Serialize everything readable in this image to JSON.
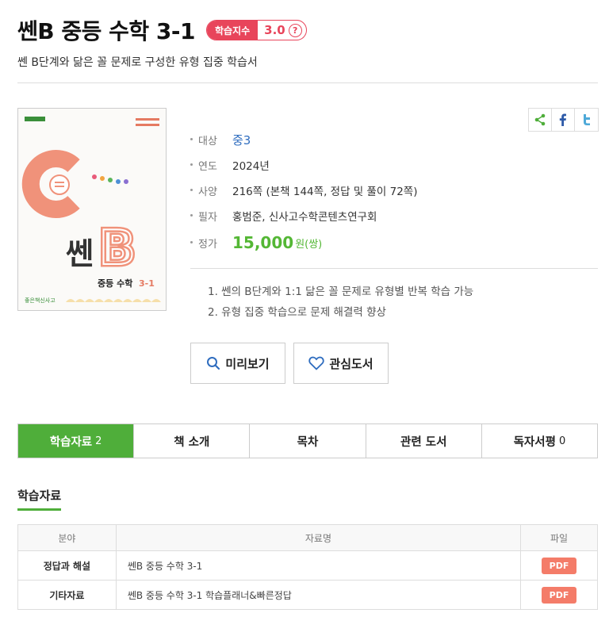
{
  "header": {
    "title": "쎈B 중등 수학 3-1",
    "score_label": "학습지수",
    "score_value": "3.0",
    "help_glyph": "?",
    "subtitle": "쎈 B단계와 닮은 꼴 문제로 구성한 유형 집중 학습서"
  },
  "cover": {
    "brand": "좋은책신사고",
    "series_title": "쎈",
    "series_letter": "B",
    "book_title": "중등 수학",
    "book_number": "3-1",
    "colors": {
      "salmon": "#f0927a",
      "cream": "#fbfaf8"
    }
  },
  "info": {
    "target_label": "대상",
    "target_value": "중3",
    "year_label": "연도",
    "year_value": "2024년",
    "spec_label": "사양",
    "spec_value": "216쪽 (본책 144쪽, 정답 및 풀이 72쪽)",
    "author_label": "필자",
    "author_value": "홍범준, 신사고수학콘텐츠연구회",
    "price_label": "정가",
    "price_value": "15,000",
    "price_unit": "원(쌍)"
  },
  "share": {
    "icons": [
      "share-icon",
      "facebook-icon",
      "twitter-icon"
    ]
  },
  "features": [
    "1. 쎈의 B단계와 1:1 닮은 꼴 문제로 유형별 반복 학습 가능",
    "2. 유형 집중 학습으로 문제 해결력 향상"
  ],
  "actions": {
    "preview_label": "미리보기",
    "favorite_label": "관심도서"
  },
  "tabs": [
    {
      "label": "학습자료",
      "count": "2"
    },
    {
      "label": "책 소개",
      "count": ""
    },
    {
      "label": "목차",
      "count": ""
    },
    {
      "label": "관련 도서",
      "count": ""
    },
    {
      "label": "독자서평",
      "count": "0"
    }
  ],
  "materials": {
    "section_title": "학습자료",
    "headers": [
      "분야",
      "자료명",
      "파일"
    ],
    "rows": [
      {
        "category": "정답과 해설",
        "name": "쎈B 중등 수학 3-1",
        "file": "PDF"
      },
      {
        "category": "기타자료",
        "name": "쎈B 중등 수학 3-1 학습플래너&빠른정답",
        "file": "PDF"
      }
    ]
  },
  "colors": {
    "accent_green": "#4fae3a",
    "accent_red": "#e8455b",
    "accent_blue": "#2f6dbf",
    "pdf_orange": "#f47c69"
  }
}
